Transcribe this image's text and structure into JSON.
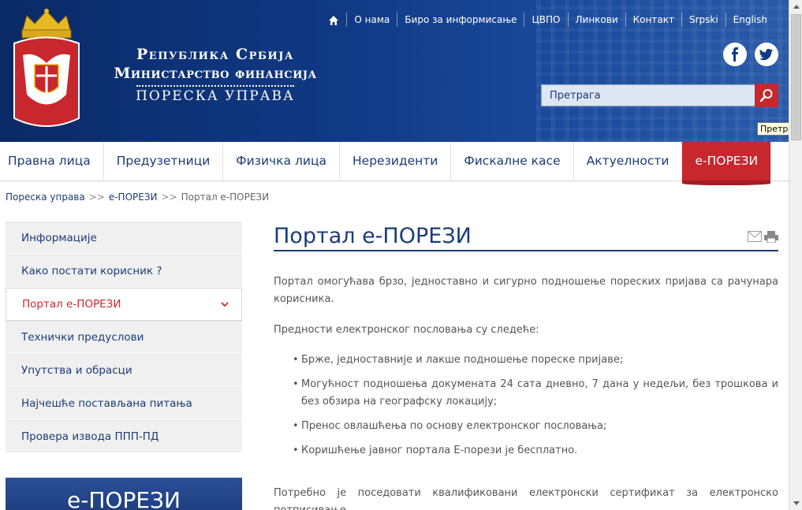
{
  "header": {
    "title_line1": "Република Србија",
    "title_line2": "Министарство финансија",
    "title_line3": "ПОРЕСКА УПРАВА",
    "topnav": [
      "О нама",
      "Биро за информисање",
      "ЦВПО",
      "Линкови",
      "Контакт",
      "Srpski",
      "English"
    ],
    "search_placeholder": "Претрага",
    "search_tooltip": "Претрага",
    "social": [
      "facebook-icon",
      "twitter-icon"
    ]
  },
  "mainnav": {
    "items": [
      "Правна лица",
      "Предузетници",
      "Физичка лица",
      "Нерезиденти",
      "Фискалне касе",
      "Актуелности",
      "е-ПОРЕЗИ"
    ],
    "active": "е-ПОРЕЗИ"
  },
  "breadcrumb": {
    "items": [
      "Пореска управа",
      "е-ПОРЕЗИ"
    ],
    "separator": ">>",
    "current": "Портал е-ПОРЕЗИ"
  },
  "sidebar": {
    "items": [
      "Информације",
      "Како постати корисник ?",
      "Портал е-ПОРЕЗИ",
      "Технички предуслови",
      "Упутства и обрасци",
      "Најчешће постављана питања",
      "Провера извода ППП-ПД"
    ],
    "active": "Портал е-ПОРЕЗИ",
    "banner": "е-ПОРЕЗИ"
  },
  "content": {
    "title": "Портал е-ПОРЕЗИ",
    "intro": "Портал омогућава брзо, једноставно и сигурно подношење пореских  пријава са рачунара корисника.",
    "advantages_heading": "Предности електронског пословања су следеће:",
    "advantages": [
      "Брже, једноставније и лакше подношење пореске пријаве;",
      "Могућност подношења докумената 24 сата дневно, 7 дана у недељи, без трошкова и без обзира на географску локацију;",
      "Пренос овлашћења по основу електронског пословања;",
      "Коришћење јавног портала Е-порези је бесплатно."
    ],
    "footer_para": "Потребно је поседовати квалификовани електронски сертификат за електронско потписивање,"
  },
  "colors": {
    "header_blue": "#113a86",
    "brand_blue": "#1b3c78",
    "accent_red": "#c8272e"
  }
}
